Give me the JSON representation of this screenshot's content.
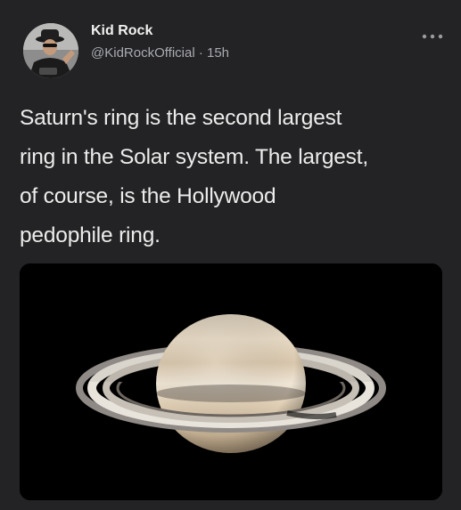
{
  "tweet": {
    "author_name": "Kid Rock",
    "handle": "@KidRockOfficial",
    "separator": "·",
    "timestamp": "15h",
    "more_icon": "more-horizontal-icon",
    "text_lines": [
      "Saturn's ring is the second largest",
      "ring in the Solar system. The largest,",
      "of course, is the Hollywood",
      "pedophile ring."
    ],
    "media": {
      "subject": "saturn-image"
    }
  },
  "colors": {
    "background": "#232325",
    "name": "#f1f1f1",
    "handle": "#a8abaf",
    "text": "#ececec"
  }
}
